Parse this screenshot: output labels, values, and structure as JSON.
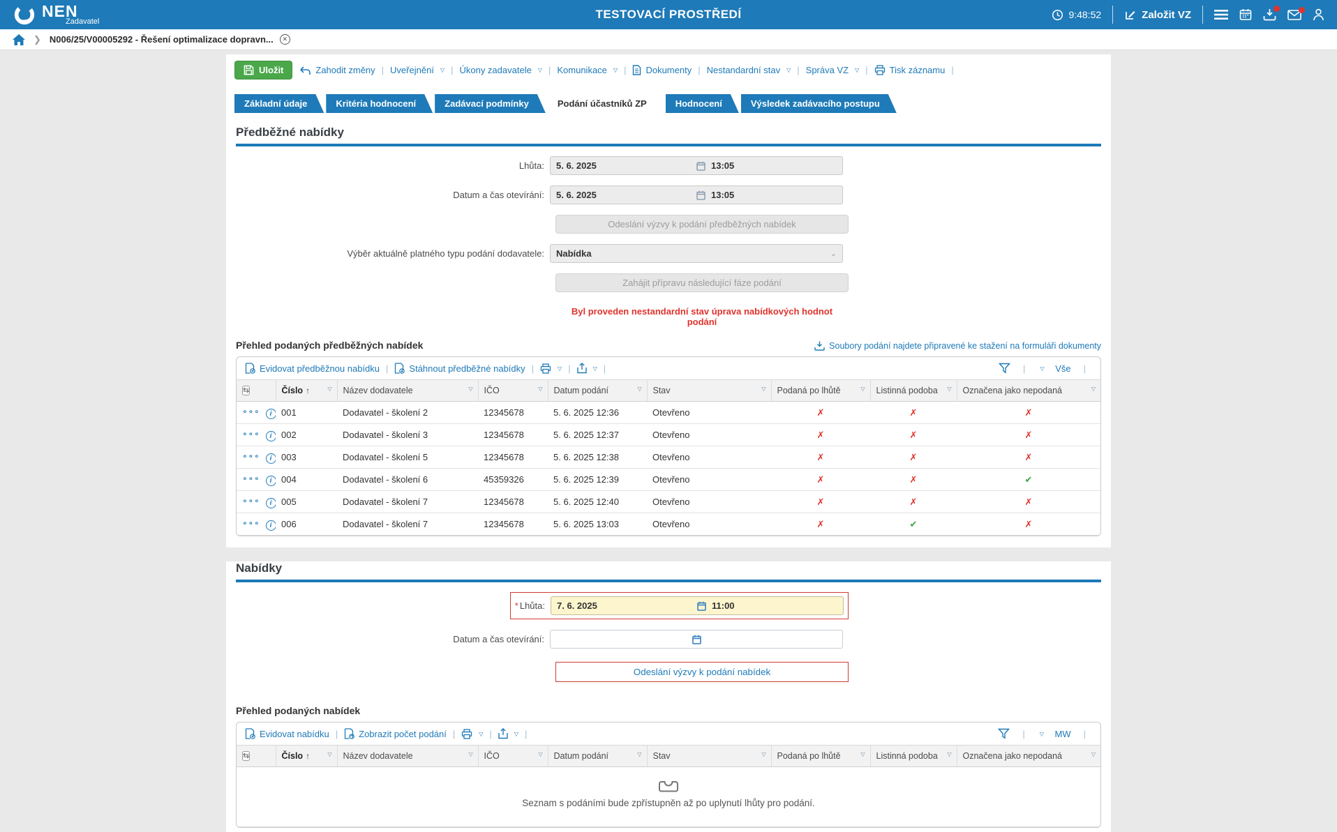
{
  "header": {
    "brand": "NEN",
    "brand_sub": "Zadavatel",
    "env_title": "TESTOVACÍ PROSTŘEDÍ",
    "time": "9:48:52",
    "create_vz": "Založit VZ"
  },
  "breadcrumb": {
    "item": "N006/25/V00005292 - Řešení optimalizace dopravn..."
  },
  "toolbar": {
    "save": "Uložit",
    "discard": "Zahodit změny",
    "publish": "Uveřejnění",
    "contracting_actions": "Úkony zadavatele",
    "communication": "Komunikace",
    "documents": "Dokumenty",
    "nonstandard_state": "Nestandardní stav",
    "manage_vz": "Správa VZ",
    "print_record": "Tisk záznamu"
  },
  "tabs": [
    "Základní údaje",
    "Kritéria hodnocení",
    "Zadávací podmínky",
    "Podání účastníků ZP",
    "Hodnocení",
    "Výsledek zadávacího postupu"
  ],
  "grid_columns": [
    "Číslo",
    "Název dodavatele",
    "IČO",
    "Datum podání",
    "Stav",
    "Podaná po lhůtě",
    "Listinná podoba",
    "Označena jako nepodaná"
  ],
  "section1": {
    "title": "Předběžné nabídky",
    "deadline_label": "Lhůta:",
    "deadline_date": "5. 6. 2025",
    "deadline_time": "13:05",
    "opening_label": "Datum a čas otevírání:",
    "opening_date": "5. 6. 2025",
    "opening_time": "13:05",
    "send_call_button": "Odeslání výzvy k podání předběžných nabídek",
    "type_select_label": "Výběr aktuálně platného typu podání dodavatele:",
    "type_select_value": "Nabídka",
    "next_phase_button": "Zahájit přípravu následující fáze podání",
    "warning": "Byl proveden nestandardní stav úprava nabídkových hodnot podání",
    "grid_title": "Přehled podaných předběžných nabídek",
    "files_link": "Soubory podání najdete připravené ke stažení na formuláři dokumenty",
    "action_register": "Evidovat předběžnou nabídku",
    "action_download": "Stáhnout předběžné nabídky",
    "filter_view": "Vše",
    "rows": [
      {
        "cislo": "001",
        "nazev": "Dodavatel - školení 2",
        "ico": "12345678",
        "datum": "5. 6. 2025 12:36",
        "stav": "Otevřeno",
        "flags": [
          "no",
          "no",
          "no"
        ]
      },
      {
        "cislo": "002",
        "nazev": "Dodavatel - školení 3",
        "ico": "12345678",
        "datum": "5. 6. 2025 12:37",
        "stav": "Otevřeno",
        "flags": [
          "no",
          "no",
          "no"
        ]
      },
      {
        "cislo": "003",
        "nazev": "Dodavatel - školení 5",
        "ico": "12345678",
        "datum": "5. 6. 2025 12:38",
        "stav": "Otevřeno",
        "flags": [
          "no",
          "no",
          "no"
        ]
      },
      {
        "cislo": "004",
        "nazev": "Dodavatel - školení 6",
        "ico": "45359326",
        "datum": "5. 6. 2025 12:39",
        "stav": "Otevřeno",
        "flags": [
          "no",
          "no",
          "yes"
        ]
      },
      {
        "cislo": "005",
        "nazev": "Dodavatel - školení 7",
        "ico": "12345678",
        "datum": "5. 6. 2025 12:40",
        "stav": "Otevřeno",
        "flags": [
          "no",
          "no",
          "no"
        ]
      },
      {
        "cislo": "006",
        "nazev": "Dodavatel - školení 7",
        "ico": "12345678",
        "datum": "5. 6. 2025 13:03",
        "stav": "Otevřeno",
        "flags": [
          "no",
          "yes",
          "no"
        ]
      }
    ]
  },
  "section2": {
    "title": "Nabídky",
    "required_mark": "*",
    "deadline_label": "Lhůta:",
    "deadline_date": "7. 6. 2025",
    "deadline_time": "11:00",
    "opening_label": "Datum a čas otevírání:",
    "send_call_button": "Odeslání výzvy k podání nabídek",
    "grid_title": "Přehled podaných nabídek",
    "action_register": "Evidovat nabídku",
    "action_count": "Zobrazit počet podání",
    "filter_view": "MW",
    "empty_text": "Seznam s podáními bude zpřístupněn až po uplynutí lhůty pro podání."
  },
  "colors": {
    "accent_blue": "#1e7ab8",
    "save_green": "#4aa74a",
    "danger_red": "#e0332d",
    "success_green": "#3fa33f",
    "required_field_yellow": "#fcf5cd"
  }
}
